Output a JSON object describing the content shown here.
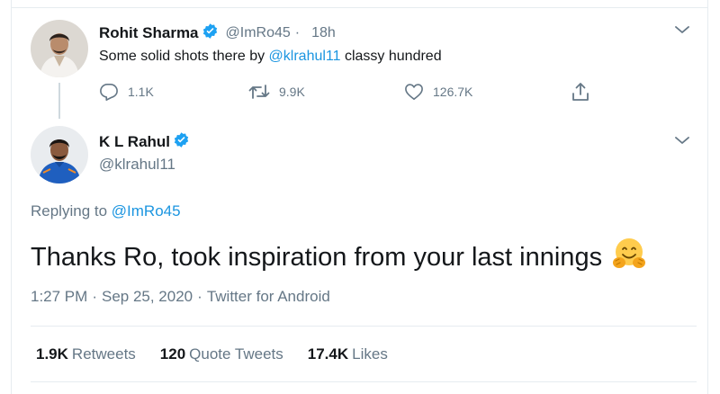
{
  "reply_tweet": {
    "author_name": "Rohit Sharma",
    "handle": "@ImRo45",
    "time_ago": "18h",
    "text_prefix": "Some solid shots there by ",
    "text_mention": "@klrahul11",
    "text_suffix": " classy hundred",
    "replies": "1.1K",
    "retweets": "9.9K",
    "likes": "126.7K"
  },
  "main_tweet": {
    "author_name": "K L Rahul",
    "handle": "@klrahul11",
    "replying_label": "Replying to ",
    "replying_handle": "@ImRo45",
    "text": "Thanks Ro, took inspiration from your last innings",
    "emoji": "hugging-face-icon",
    "time": "1:27 PM",
    "date": "Sep 25, 2020",
    "source": "Twitter for Android",
    "stats": {
      "retweets_num": "1.9K",
      "retweets_label": "Retweets",
      "quote_num": "120",
      "quote_label": "Quote Tweets",
      "likes_num": "17.4K",
      "likes_label": "Likes"
    }
  },
  "colors": {
    "accent": "#1b95e0",
    "secondary_text": "#657786",
    "primary_text": "#14171a",
    "verified": "#1da1f2"
  }
}
